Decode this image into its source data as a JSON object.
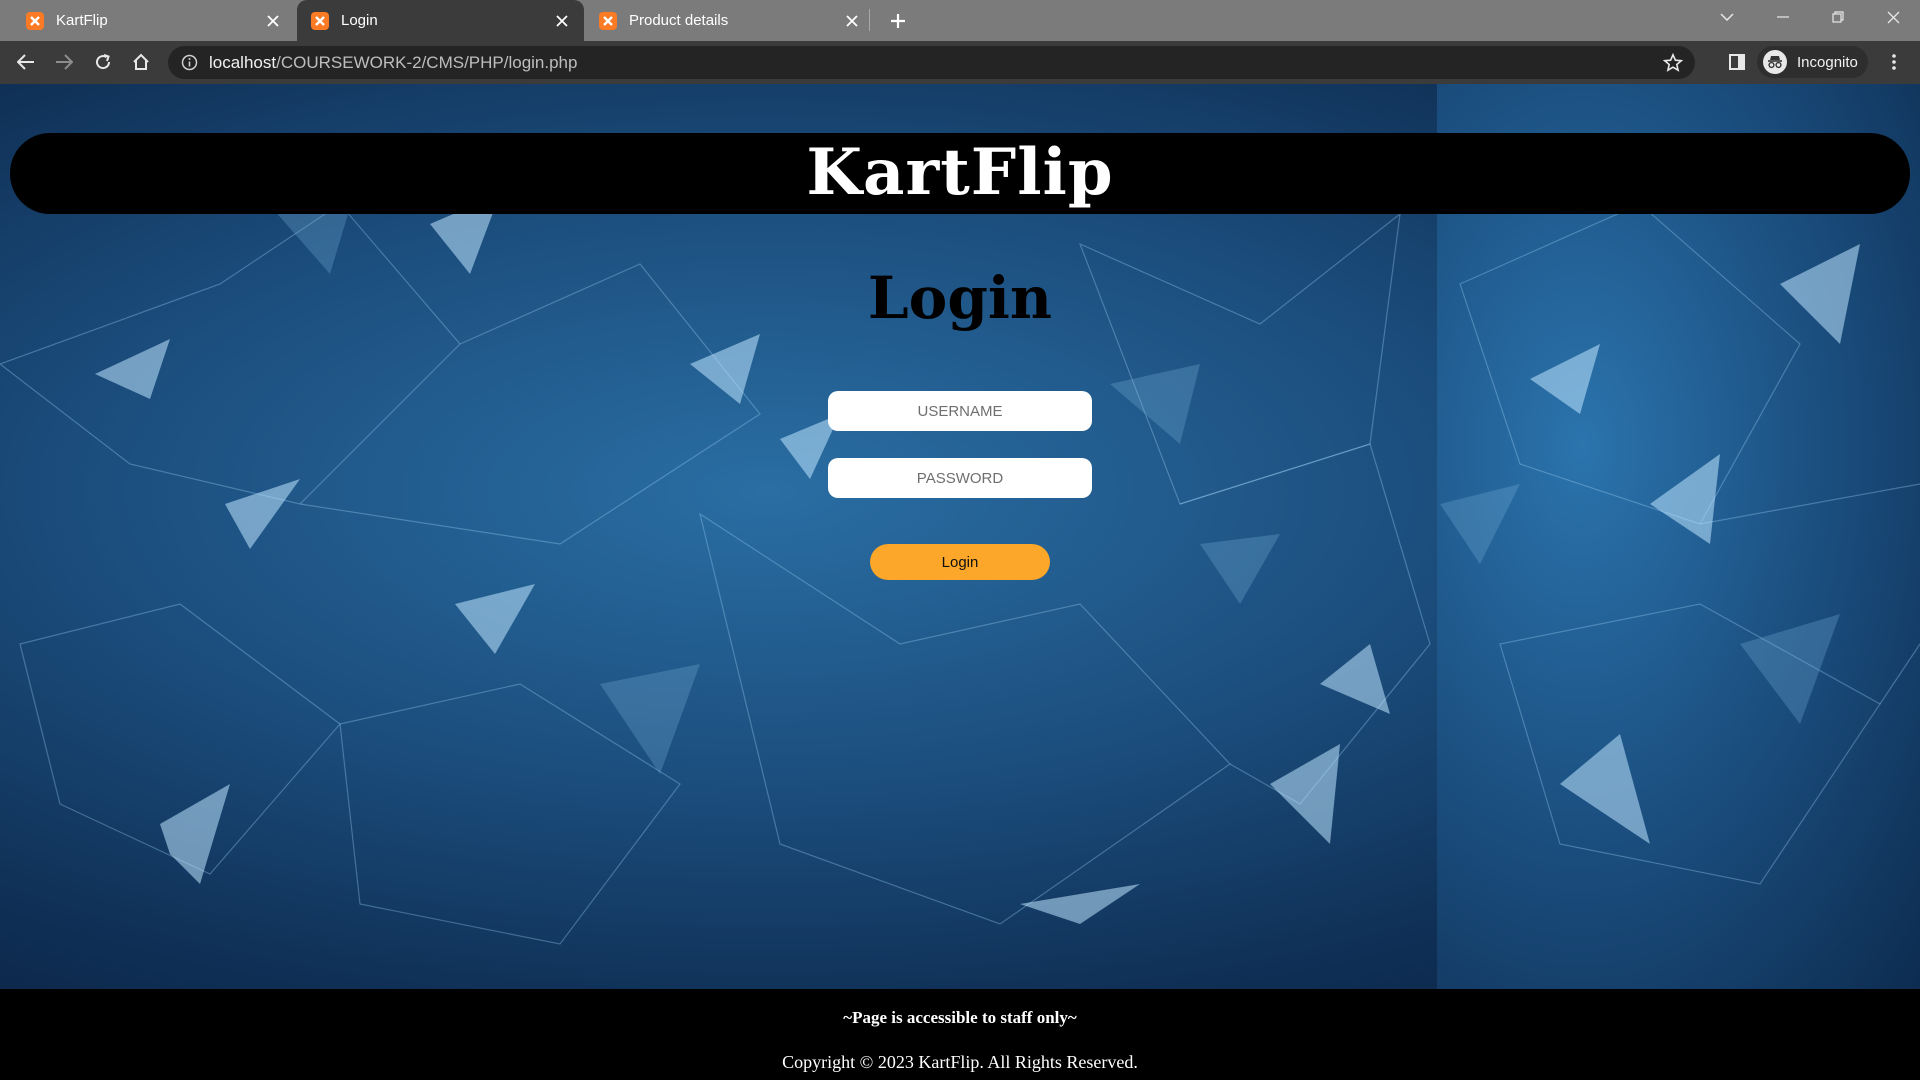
{
  "browser": {
    "tabs": [
      {
        "title": "KartFlip",
        "active": false
      },
      {
        "title": "Login",
        "active": true
      },
      {
        "title": "Product details",
        "active": false
      }
    ],
    "url_host": "localhost",
    "url_path": "/COURSEWORK-2/CMS/PHP/login.php",
    "profile_label": "Incognito",
    "favicon_color": "#fb7a24"
  },
  "page": {
    "brand": "KartFlip",
    "heading": "Login",
    "username_placeholder": "USERNAME",
    "password_placeholder": "PASSWORD",
    "login_button": "Login",
    "footer_note": "~Page is accessible to staff only~",
    "footer_copyright": "Copyright © 2023 KartFlip. All Rights Reserved.",
    "accent_color": "#fca62a"
  }
}
